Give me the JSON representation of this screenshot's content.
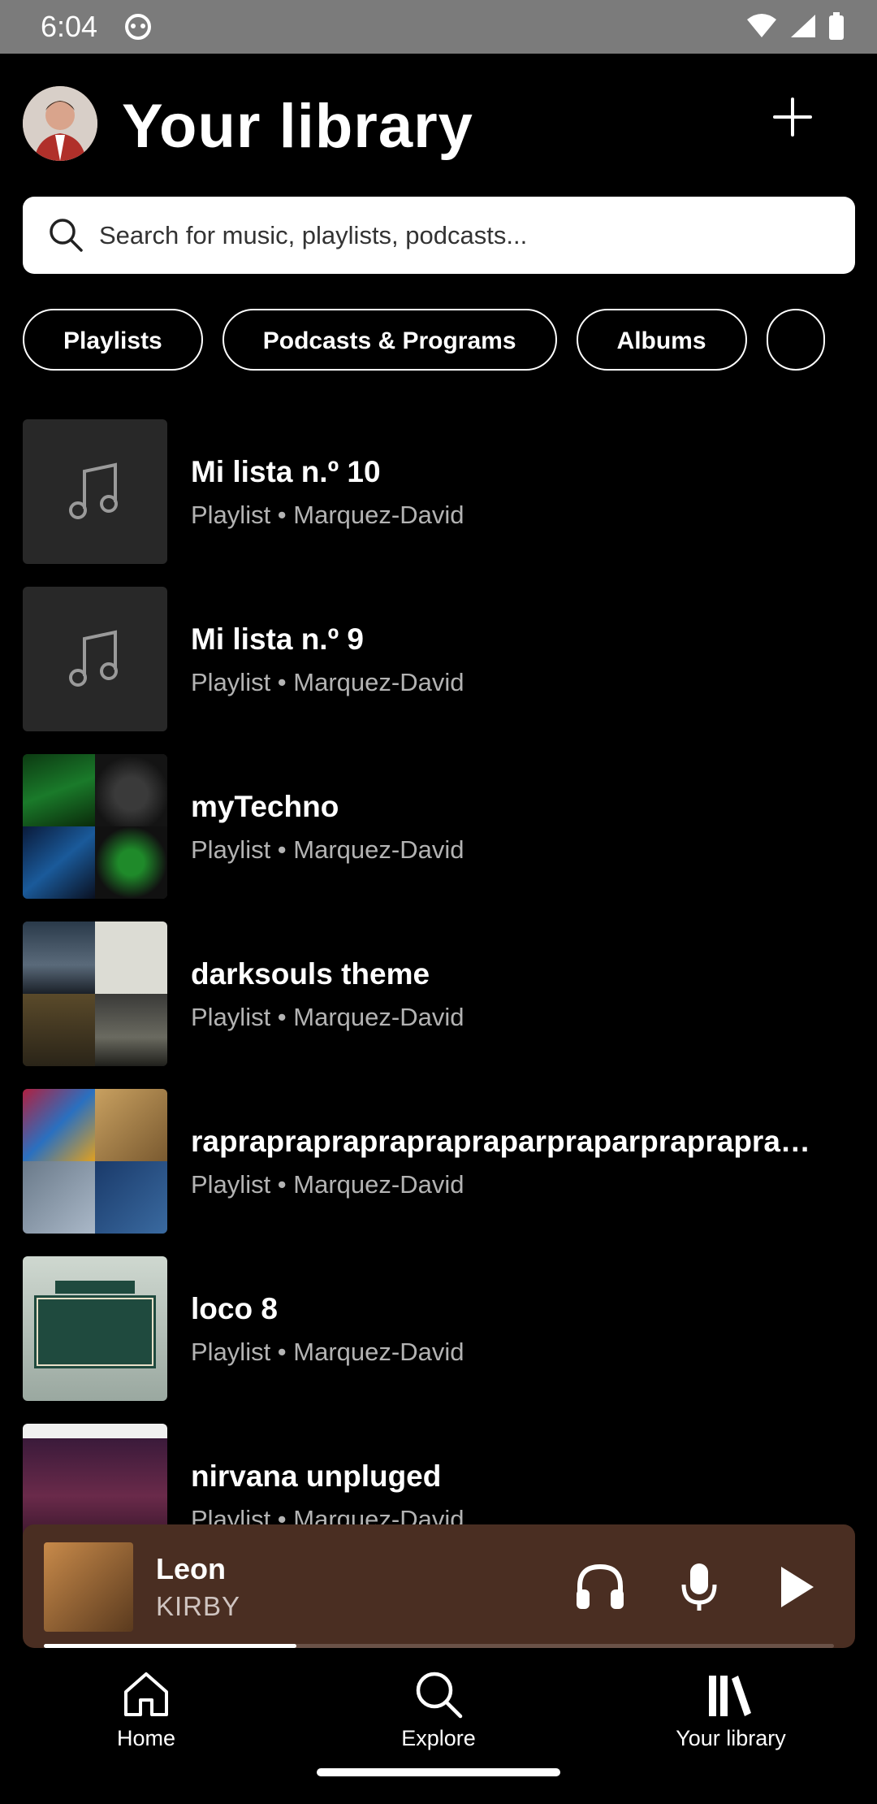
{
  "status_bar": {
    "time": "6:04"
  },
  "header": {
    "title": "Your library",
    "add_icon": "plus-icon"
  },
  "search": {
    "placeholder": "Search for music, playlists, podcasts..."
  },
  "filters": [
    "Playlists",
    "Podcasts & Programs",
    "Albums"
  ],
  "library_items": [
    {
      "name": "Mi lista n.º 10",
      "subtitle": "Playlist • Marquez-David",
      "cover": "music-note-placeholder"
    },
    {
      "name": "Mi lista n.º 9",
      "subtitle": "Playlist • Marquez-David",
      "cover": "music-note-placeholder"
    },
    {
      "name": "myTechno",
      "subtitle": "Playlist • Marquez-David",
      "cover": "collage"
    },
    {
      "name": "darksouls theme",
      "subtitle": "Playlist • Marquez-David",
      "cover": "collage"
    },
    {
      "name": "raprapraprapraprapraparpraparprapraprapra…",
      "subtitle": "Playlist • Marquez-David",
      "cover": "collage"
    },
    {
      "name": "loco 8",
      "subtitle": "Playlist • Marquez-David",
      "cover": "poble-nostrum-art"
    },
    {
      "name": "nirvana unpluged",
      "subtitle": "Playlist • Marquez-David",
      "cover": "album-art"
    }
  ],
  "now_playing": {
    "song": "Leon",
    "artist": "KIRBY",
    "progress": 0.32,
    "color": "#4a2e22"
  },
  "bottom_nav": {
    "home": "Home",
    "explore": "Explore",
    "library": "Your library"
  }
}
